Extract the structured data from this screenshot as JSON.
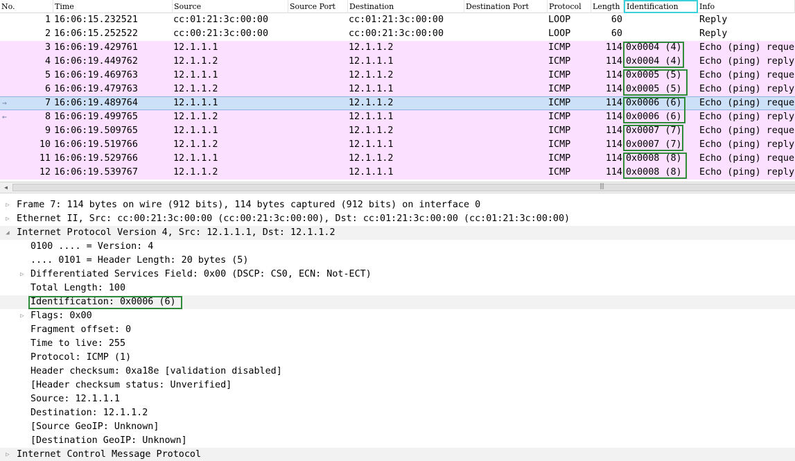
{
  "packet_list": {
    "columns": [
      "No.",
      "Time",
      "Source",
      "Source Port",
      "Destination",
      "Destination Port",
      "Protocol",
      "Length",
      "Identification",
      "Info"
    ],
    "active_column": "Identification",
    "rows": [
      {
        "no": "1",
        "time": "16:06:15.232521",
        "source": "cc:01:21:3c:00:00",
        "source_port": "",
        "destination": "cc:01:21:3c:00:00",
        "destination_port": "",
        "protocol": "LOOP",
        "length": "60",
        "identification": "",
        "info": "Reply",
        "style": "plain",
        "rel": ""
      },
      {
        "no": "2",
        "time": "16:06:15.252522",
        "source": "cc:00:21:3c:00:00",
        "source_port": "",
        "destination": "cc:00:21:3c:00:00",
        "destination_port": "",
        "protocol": "LOOP",
        "length": "60",
        "identification": "",
        "info": "Reply",
        "style": "plain",
        "rel": ""
      },
      {
        "no": "3",
        "time": "16:06:19.429761",
        "source": "12.1.1.1",
        "source_port": "",
        "destination": "12.1.1.2",
        "destination_port": "",
        "protocol": "ICMP",
        "length": "114",
        "identification": "0x0004 (4)",
        "info": "Echo (ping) request",
        "style": "icmp",
        "rel": ""
      },
      {
        "no": "4",
        "time": "16:06:19.449762",
        "source": "12.1.1.2",
        "source_port": "",
        "destination": "12.1.1.1",
        "destination_port": "",
        "protocol": "ICMP",
        "length": "114",
        "identification": "0x0004 (4)",
        "info": "Echo (ping) reply",
        "style": "icmp",
        "rel": ""
      },
      {
        "no": "5",
        "time": "16:06:19.469763",
        "source": "12.1.1.1",
        "source_port": "",
        "destination": "12.1.1.2",
        "destination_port": "",
        "protocol": "ICMP",
        "length": "114",
        "identification": "0x0005 (5)",
        "info": "Echo (ping) request",
        "style": "icmp",
        "rel": ""
      },
      {
        "no": "6",
        "time": "16:06:19.479763",
        "source": "12.1.1.2",
        "source_port": "",
        "destination": "12.1.1.1",
        "destination_port": "",
        "protocol": "ICMP",
        "length": "114",
        "identification": "0x0005 (5)",
        "info": "Echo (ping) reply",
        "style": "icmp",
        "rel": ""
      },
      {
        "no": "7",
        "time": "16:06:19.489764",
        "source": "12.1.1.1",
        "source_port": "",
        "destination": "12.1.1.2",
        "destination_port": "",
        "protocol": "ICMP",
        "length": "114",
        "identification": "0x0006 (6)",
        "info": "Echo (ping) request",
        "style": "selected",
        "rel": "→"
      },
      {
        "no": "8",
        "time": "16:06:19.499765",
        "source": "12.1.1.2",
        "source_port": "",
        "destination": "12.1.1.1",
        "destination_port": "",
        "protocol": "ICMP",
        "length": "114",
        "identification": "0x0006 (6)",
        "info": "Echo (ping) reply",
        "style": "icmp",
        "rel": "←"
      },
      {
        "no": "9",
        "time": "16:06:19.509765",
        "source": "12.1.1.1",
        "source_port": "",
        "destination": "12.1.1.2",
        "destination_port": "",
        "protocol": "ICMP",
        "length": "114",
        "identification": "0x0007 (7)",
        "info": "Echo (ping) request",
        "style": "icmp",
        "rel": ""
      },
      {
        "no": "10",
        "time": "16:06:19.519766",
        "source": "12.1.1.2",
        "source_port": "",
        "destination": "12.1.1.1",
        "destination_port": "",
        "protocol": "ICMP",
        "length": "114",
        "identification": "0x0007 (7)",
        "info": "Echo (ping) reply",
        "style": "icmp",
        "rel": ""
      },
      {
        "no": "11",
        "time": "16:06:19.529766",
        "source": "12.1.1.1",
        "source_port": "",
        "destination": "12.1.1.2",
        "destination_port": "",
        "protocol": "ICMP",
        "length": "114",
        "identification": "0x0008 (8)",
        "info": "Echo (ping) request",
        "style": "icmp",
        "rel": ""
      },
      {
        "no": "12",
        "time": "16:06:19.539767",
        "source": "12.1.1.2",
        "source_port": "",
        "destination": "12.1.1.1",
        "destination_port": "",
        "protocol": "ICMP",
        "length": "114",
        "identification": "0x0008 (8)",
        "info": "Echo (ping) reply",
        "style": "icmp",
        "rel": ""
      }
    ]
  },
  "scrollbar": {
    "left_arrow": "◀",
    "grip": "|||"
  },
  "details": {
    "rows": [
      {
        "text": "Frame 7: 114 bytes on wire (912 bits), 114 bytes captured (912 bits) on interface 0",
        "level": 0,
        "toggle": "collapsed",
        "highlight": false
      },
      {
        "text": "Ethernet II, Src: cc:00:21:3c:00:00 (cc:00:21:3c:00:00), Dst: cc:01:21:3c:00:00 (cc:01:21:3c:00:00)",
        "level": 0,
        "toggle": "collapsed",
        "highlight": false
      },
      {
        "text": "Internet Protocol Version 4, Src: 12.1.1.1, Dst: 12.1.1.2",
        "level": 0,
        "toggle": "expanded",
        "highlight": false
      },
      {
        "text": "0100 .... = Version: 4",
        "level": 1,
        "toggle": "none",
        "highlight": false
      },
      {
        "text": ".... 0101 = Header Length: 20 bytes (5)",
        "level": 1,
        "toggle": "none",
        "highlight": false
      },
      {
        "text": "Differentiated Services Field: 0x00 (DSCP: CS0, ECN: Not-ECT)",
        "level": 1,
        "toggle": "collapsed",
        "highlight": false
      },
      {
        "text": "Total Length: 100",
        "level": 1,
        "toggle": "none",
        "highlight": false
      },
      {
        "text": "Identification: 0x0006 (6)",
        "level": 1,
        "toggle": "none",
        "highlight": true
      },
      {
        "text": "Flags: 0x00",
        "level": 1,
        "toggle": "collapsed",
        "highlight": false
      },
      {
        "text": "Fragment offset: 0",
        "level": 1,
        "toggle": "none",
        "highlight": false
      },
      {
        "text": "Time to live: 255",
        "level": 1,
        "toggle": "none",
        "highlight": false
      },
      {
        "text": "Protocol: ICMP (1)",
        "level": 1,
        "toggle": "none",
        "highlight": false
      },
      {
        "text": "Header checksum: 0xa18e [validation disabled]",
        "level": 1,
        "toggle": "none",
        "highlight": false
      },
      {
        "text": "[Header checksum status: Unverified]",
        "level": 1,
        "toggle": "none",
        "highlight": false
      },
      {
        "text": "Source: 12.1.1.1",
        "level": 1,
        "toggle": "none",
        "highlight": false
      },
      {
        "text": "Destination: 12.1.1.2",
        "level": 1,
        "toggle": "none",
        "highlight": false
      },
      {
        "text": "[Source GeoIP: Unknown]",
        "level": 1,
        "toggle": "none",
        "highlight": false
      },
      {
        "text": "[Destination GeoIP: Unknown]",
        "level": 1,
        "toggle": "none",
        "highlight": false
      },
      {
        "text": "Internet Control Message Protocol",
        "level": 0,
        "toggle": "collapsed",
        "highlight": false
      }
    ]
  },
  "icons": {
    "collapsed": "▷",
    "expanded": "◢"
  },
  "colors": {
    "icmp_row": "#fce0ff",
    "selected_row": "#cce1f8",
    "annotation_box": "#2e8b3a",
    "active_header_box": "#3ad0dc"
  }
}
